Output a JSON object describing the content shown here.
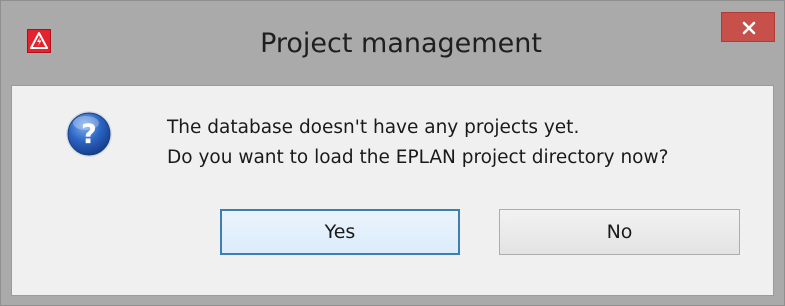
{
  "window": {
    "title": "Project management",
    "close_icon": "close-icon",
    "app_icon": "eplan-warning-icon"
  },
  "message": {
    "icon": "question-icon",
    "line1": "The database doesn't have any projects yet.",
    "line2": "Do you want to load the EPLAN project directory now?"
  },
  "buttons": {
    "yes_label": "Yes",
    "no_label": "No"
  },
  "colors": {
    "titlebar": "#aaaaaa",
    "close_button": "#c7504b",
    "client_background": "#f0f0f0",
    "default_button_border": "#3c7fb1",
    "app_icon_red": "#e3232d"
  }
}
